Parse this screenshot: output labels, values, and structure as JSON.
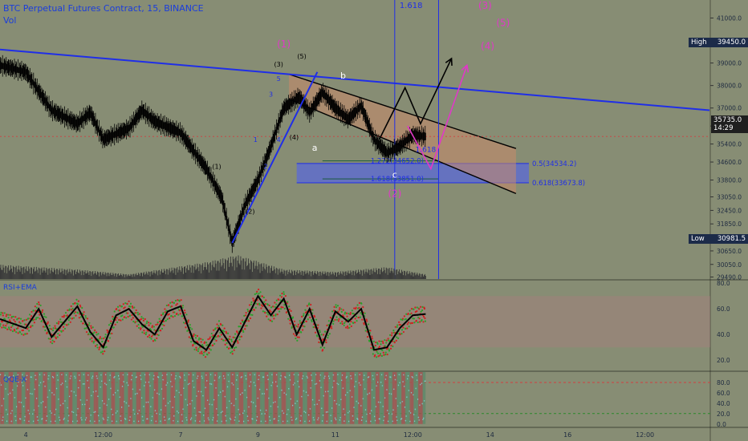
{
  "header": {
    "title": "BTC Perpetual Futures Contract, 15, BINANCE",
    "volume_label": "Vol"
  },
  "badges": {
    "high_label": "High",
    "high_value": "39450.0",
    "low_label": "Low",
    "low_value": "30981.5",
    "last_value": "35735.0",
    "countdown": "14:29"
  },
  "indicators": {
    "rsi_label": "RSI+EMA",
    "stoch_label": "QQE-X"
  },
  "colors": {
    "background": "#878d74",
    "price": "#000000",
    "trendline": "#1f2ee8",
    "wave_major": "#e038c8",
    "rsi": "#000000",
    "rsi_ema": "#d02020",
    "rsi_signal": "#2aa02a",
    "stoch_a": "#7fd0d0",
    "stoch_b": "#c04040"
  },
  "chart_data": [
    {
      "type": "candlestick",
      "title": "BTC Perpetual Futures Contract, 15, BINANCE",
      "y_ticks": [
        41000,
        40000,
        39000,
        38000,
        37000,
        36200,
        35400,
        34600,
        33800,
        33050,
        32450,
        31850,
        31250,
        30650,
        30050,
        29490
      ],
      "y_ticks_display": [
        "41000.0",
        "40000.0",
        "39000.0",
        "38000.0",
        "37000.0",
        "36200.0",
        "35400.0",
        "34600.0",
        "33800.0",
        "33050.0",
        "32450.0",
        "31850.0",
        "31250.0",
        "30650.0",
        "30050.0",
        "29490.0"
      ],
      "ylim": [
        29400,
        41800
      ],
      "x_ticks": [
        "4",
        "12:00",
        "7",
        "9",
        "11",
        "12:00",
        "14",
        "16",
        "12:00"
      ],
      "x_tick_pos": [
        0,
        3,
        6,
        9,
        12,
        15,
        18,
        21,
        24
      ],
      "xlim": [
        -1,
        26.5
      ],
      "price_path": [
        [
          -1,
          38900
        ],
        [
          0,
          38600
        ],
        [
          1,
          36900
        ],
        [
          2,
          36300
        ],
        [
          2.5,
          36800
        ],
        [
          3,
          35600
        ],
        [
          4,
          36100
        ],
        [
          4.5,
          36900
        ],
        [
          5,
          36400
        ],
        [
          6,
          35900
        ],
        [
          7,
          34300
        ],
        [
          7.6,
          33000
        ],
        [
          8,
          31000
        ],
        [
          8.5,
          32700
        ],
        [
          9,
          33800
        ],
        [
          9.5,
          35300
        ],
        [
          10,
          37000
        ],
        [
          10.6,
          37500
        ],
        [
          11,
          36800
        ],
        [
          11.5,
          37700
        ],
        [
          12,
          37000
        ],
        [
          12.5,
          36500
        ],
        [
          13,
          37100
        ],
        [
          13.5,
          35600
        ],
        [
          14,
          35000
        ],
        [
          14.5,
          35300
        ],
        [
          15,
          35800
        ],
        [
          15.5,
          35735
        ]
      ],
      "volume_path": [
        [
          -1,
          0.3
        ],
        [
          2,
          0.2
        ],
        [
          4,
          0.1
        ],
        [
          7,
          0.35
        ],
        [
          8.2,
          0.5
        ],
        [
          10,
          0.2
        ],
        [
          12,
          0.15
        ],
        [
          14,
          0.25
        ],
        [
          15.5,
          0.1
        ]
      ],
      "last_price": 35735,
      "high": 39450,
      "low": 30981.5,
      "vertical_lines": [
        {
          "x": 14.3,
          "label": "1.618"
        },
        {
          "x": 16
        }
      ],
      "trendlines": [
        {
          "from": [
            -1,
            39600
          ],
          "to": [
            26.5,
            36900
          ]
        },
        {
          "from": [
            8,
            31000
          ],
          "to": [
            11.3,
            38600
          ]
        }
      ],
      "channel": {
        "upper": [
          [
            10.2,
            38500
          ],
          [
            19,
            35200
          ]
        ],
        "lower": [
          [
            10.2,
            37400
          ],
          [
            19,
            33200
          ]
        ]
      },
      "fib_levels": [
        {
          "label": "0.5(34534.2)",
          "y": 34534.2,
          "x0": 10.5,
          "x1": 19.5
        },
        {
          "label": "0.618(33673.8)",
          "y": 33673.8,
          "x0": 10.5,
          "x1": 19.5
        },
        {
          "label": "1.272(34652.0)",
          "y": 34652.0,
          "x0": 11.5,
          "x1": 16
        },
        {
          "label": "1.618(33851.0)",
          "y": 33851.0,
          "x0": 11.5,
          "x1": 16
        }
      ],
      "annotations": [
        {
          "text": "(1)",
          "x": 10,
          "y": 39700,
          "color": "#e038c8",
          "size": 12
        },
        {
          "text": "(2)",
          "x": 14.3,
          "y": 33050,
          "color": "#e038c8",
          "size": 12
        },
        {
          "text": "(3)",
          "x": 17.8,
          "y": 41400,
          "color": "#e038c8",
          "size": 12
        },
        {
          "text": "(4)",
          "x": 17.9,
          "y": 39600,
          "color": "#e038c8",
          "size": 12
        },
        {
          "text": "(5)",
          "x": 18.5,
          "y": 40650,
          "color": "#e038c8",
          "size": 12
        },
        {
          "text": "(1)",
          "x": 7.4,
          "y": 34300,
          "color": "#000000",
          "size": 8
        },
        {
          "text": "(2)",
          "x": 8.7,
          "y": 32300,
          "color": "#000000",
          "size": 8
        },
        {
          "text": "(3)",
          "x": 9.8,
          "y": 38850,
          "color": "#000000",
          "size": 8
        },
        {
          "text": "(4)",
          "x": 10.4,
          "y": 35600,
          "color": "#000000",
          "size": 8
        },
        {
          "text": "(5)",
          "x": 10.7,
          "y": 39200,
          "color": "#000000",
          "size": 8
        },
        {
          "text": "1",
          "x": 8.9,
          "y": 35500,
          "color": "#1f2ee8",
          "size": 8
        },
        {
          "text": "2",
          "x": 9.3,
          "y": 34300,
          "color": "#1f2ee8",
          "size": 8
        },
        {
          "text": "3",
          "x": 9.5,
          "y": 37500,
          "color": "#1f2ee8",
          "size": 8
        },
        {
          "text": "4",
          "x": 9.8,
          "y": 35500,
          "color": "#1f2ee8",
          "size": 8
        },
        {
          "text": "5",
          "x": 9.8,
          "y": 38200,
          "color": "#1f2ee8",
          "size": 8
        },
        {
          "text": "a",
          "x": 11.2,
          "y": 35100,
          "color": "#ffffff",
          "size": 11
        },
        {
          "text": "b",
          "x": 12.3,
          "y": 38300,
          "color": "#ffffff",
          "size": 11
        },
        {
          "text": "c",
          "x": 14.3,
          "y": 33900,
          "color": "#ffffff",
          "size": 11
        },
        {
          "text": "1.618",
          "x": 15.5,
          "y": 35050,
          "color": "#1f2ee8",
          "size": 9
        }
      ],
      "projections": [
        {
          "points": [
            [
              13.7,
              35600
            ],
            [
              14.7,
              37900
            ],
            [
              15.3,
              36300
            ],
            [
              16.5,
              39200
            ]
          ],
          "color": "#000000"
        },
        {
          "points": [
            [
              14.8,
              36200
            ],
            [
              15.7,
              34300
            ],
            [
              17.1,
              38900
            ]
          ],
          "color": "#e038c8"
        }
      ]
    },
    {
      "type": "line",
      "title": "RSI+EMA",
      "y_ticks": [
        80,
        60,
        40,
        20
      ],
      "y_ticks_display": [
        "80.0",
        "60.0",
        "40.0",
        "20.0"
      ],
      "ylim": [
        12,
        82
      ],
      "band": [
        30,
        70
      ],
      "series": [
        {
          "points": [
            [
              -1,
              52
            ],
            [
              0,
              45
            ],
            [
              0.5,
              60
            ],
            [
              1,
              38
            ],
            [
              1.5,
              50
            ],
            [
              2,
              62
            ],
            [
              2.5,
              42
            ],
            [
              3,
              30
            ],
            [
              3.5,
              55
            ],
            [
              4,
              60
            ],
            [
              4.5,
              48
            ],
            [
              5,
              40
            ],
            [
              5.5,
              58
            ],
            [
              6,
              62
            ],
            [
              6.5,
              35
            ],
            [
              7,
              28
            ],
            [
              7.5,
              45
            ],
            [
              8,
              30
            ],
            [
              8.5,
              50
            ],
            [
              9,
              70
            ],
            [
              9.5,
              55
            ],
            [
              10,
              68
            ],
            [
              10.5,
              40
            ],
            [
              11,
              60
            ],
            [
              11.5,
              32
            ],
            [
              12,
              58
            ],
            [
              12.5,
              50
            ],
            [
              13,
              60
            ],
            [
              13.5,
              28
            ],
            [
              14,
              30
            ],
            [
              14.5,
              45
            ],
            [
              15,
              55
            ],
            [
              15.5,
              56
            ]
          ]
        }
      ]
    },
    {
      "type": "line",
      "title": "QQE-X",
      "y_ticks": [
        80,
        60,
        40,
        20,
        0
      ],
      "y_ticks_display": [
        "80.0",
        "60.0",
        "40.0",
        "20.0",
        "0.0"
      ],
      "ylim": [
        -5,
        100
      ],
      "levels": [
        80,
        20
      ],
      "series": [
        {
          "points": [
            [
              -1,
              40
            ],
            [
              1,
              80
            ],
            [
              3,
              30
            ],
            [
              5,
              70
            ],
            [
              7,
              20
            ],
            [
              9,
              90
            ],
            [
              11,
              50
            ],
            [
              13,
              80
            ],
            [
              15,
              30
            ],
            [
              15.5,
              60
            ]
          ]
        },
        {
          "points": [
            [
              -1,
              60
            ],
            [
              1,
              30
            ],
            [
              3,
              70
            ],
            [
              5,
              40
            ],
            [
              7,
              70
            ],
            [
              9,
              30
            ],
            [
              11,
              80
            ],
            [
              13,
              40
            ],
            [
              15,
              70
            ],
            [
              15.5,
              40
            ]
          ]
        }
      ]
    }
  ]
}
